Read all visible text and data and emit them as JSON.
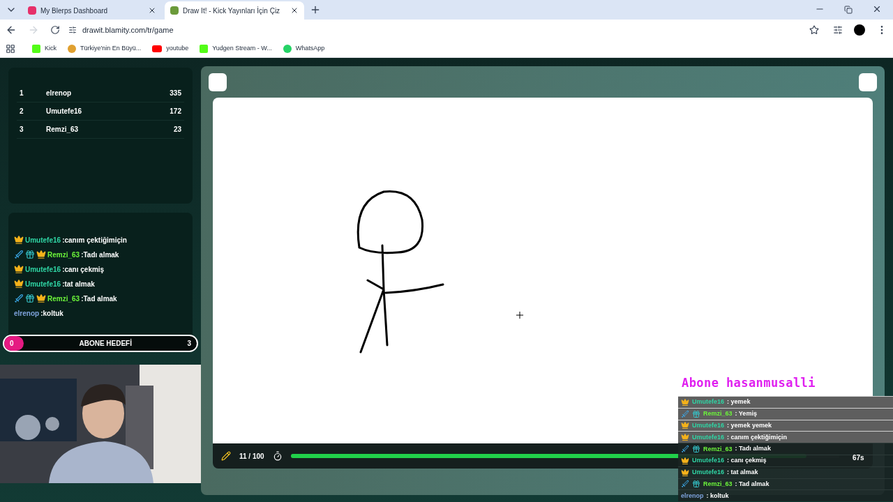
{
  "browser": {
    "tabs": [
      {
        "title": "My Blerps Dashboard",
        "selected": false
      },
      {
        "title": "Draw It! - Kick Yayınları İçin Çiz",
        "selected": true
      }
    ],
    "url": "drawit.blamity.com/tr/game",
    "bookmarks": [
      {
        "label": "Kick",
        "kind": "kick"
      },
      {
        "label": "Türkiye'nin En Büyü...",
        "kind": "emoji"
      },
      {
        "label": "youtube",
        "kind": "youtube"
      },
      {
        "label": "Yudgen Stream - W...",
        "kind": "kick"
      },
      {
        "label": "WhatsApp",
        "kind": "whatsapp"
      }
    ]
  },
  "leaderboard": [
    {
      "rank": "1",
      "name": "elrenop",
      "score": "335"
    },
    {
      "rank": "2",
      "name": "Umutefe16",
      "score": "172"
    },
    {
      "rank": "3",
      "name": "Remzi_63",
      "score": "23"
    }
  ],
  "chat": [
    {
      "user": "Umutefe16",
      "text": ":canım çektiğimiçin",
      "color": "#2fd5a4",
      "sword": false,
      "gift": false,
      "crown": true
    },
    {
      "user": "Remzi_63",
      "text": ":Tadı almak",
      "color": "#6cf53a",
      "sword": true,
      "gift": true,
      "crown": true
    },
    {
      "user": "Umutefe16",
      "text": ":canı çekmiş",
      "color": "#2fd5a4",
      "sword": false,
      "gift": false,
      "crown": true
    },
    {
      "user": "Umutefe16",
      "text": ":tat almak",
      "color": "#2fd5a4",
      "sword": false,
      "gift": false,
      "crown": true
    },
    {
      "user": "Remzi_63",
      "text": ":Tad almak",
      "color": "#6cf53a",
      "sword": true,
      "gift": true,
      "crown": true
    },
    {
      "user": "elrenop",
      "text": ":koltuk",
      "color": "#7ea3dc",
      "sword": false,
      "gift": false,
      "crown": false
    }
  ],
  "goal": {
    "current": "0",
    "label": "ABONE HEDEFİ",
    "target": "3"
  },
  "game": {
    "round": "11 / 100",
    "timer": "67s",
    "level": 0.94
  },
  "overlay": {
    "title": "Abone hasanmusalli",
    "messages": [
      {
        "user": "Umutefe16",
        "text": ": yemek",
        "color": "#2fd5a4",
        "faded": true,
        "sword": false,
        "gift": false,
        "crown": true
      },
      {
        "user": "Remzi_63",
        "text": ": Yemiş",
        "color": "#6cf53a",
        "faded": true,
        "sword": true,
        "gift": true,
        "crown": false
      },
      {
        "user": "Umutefe16",
        "text": ": yemek yemek",
        "color": "#2fd5a4",
        "faded": true,
        "sword": false,
        "gift": false,
        "crown": true
      },
      {
        "user": "Umutefe16",
        "text": ": canım çektiğimiçin",
        "color": "#2fd5a4",
        "faded": true,
        "sword": false,
        "gift": false,
        "crown": true
      },
      {
        "user": "Remzi_63",
        "text": ": Tadı almak",
        "color": "#6cf53a",
        "faded": false,
        "sword": true,
        "gift": true,
        "crown": false
      },
      {
        "user": "Umutefe16",
        "text": ": canı çekmiş",
        "color": "#2fd5a4",
        "faded": false,
        "sword": false,
        "gift": false,
        "crown": true
      },
      {
        "user": "Umutefe16",
        "text": ": tat almak",
        "color": "#2fd5a4",
        "faded": false,
        "sword": false,
        "gift": false,
        "crown": true
      },
      {
        "user": "Remzi_63",
        "text": ": Tad almak",
        "color": "#6cf53a",
        "faded": false,
        "sword": true,
        "gift": true,
        "crown": false
      },
      {
        "user": "elrenop",
        "text": ": koltuk",
        "color": "#7ea3dc",
        "faded": false,
        "sword": false,
        "gift": false,
        "crown": false
      }
    ]
  }
}
